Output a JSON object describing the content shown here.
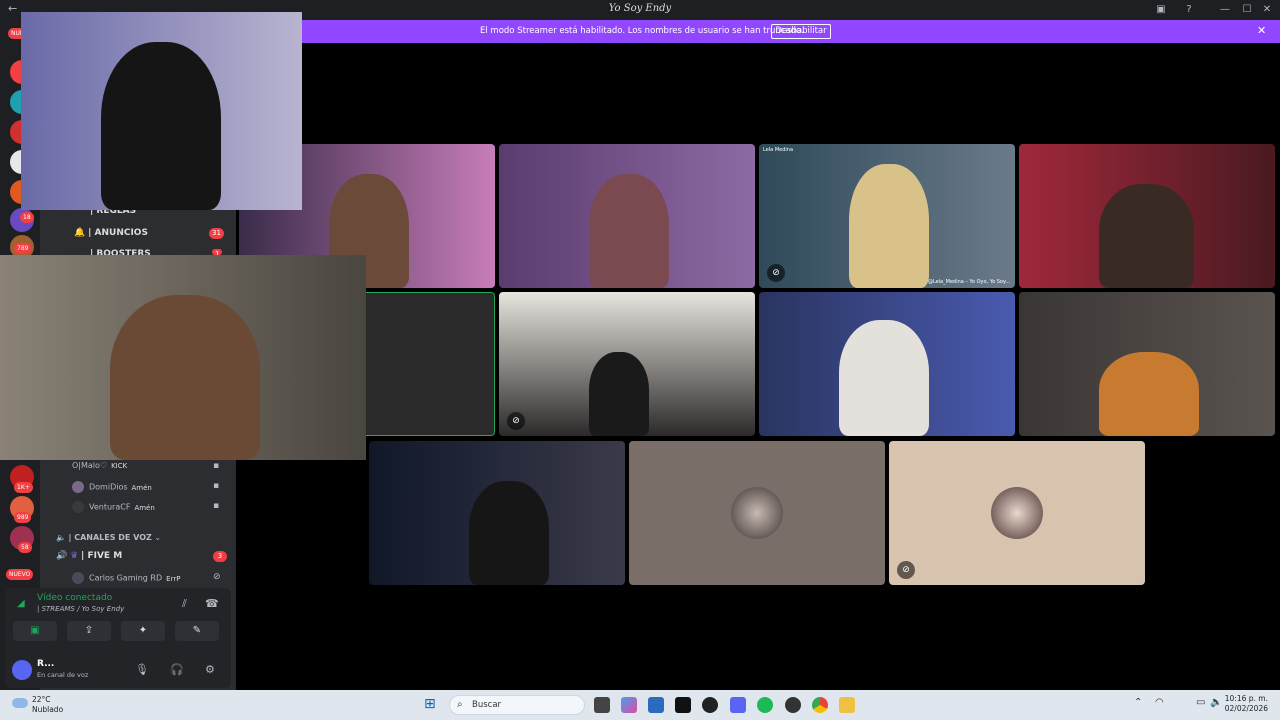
{
  "window": {
    "title": "Yo Soy Endy",
    "back_label": "←",
    "minimize": "—",
    "maximize": "☐",
    "close": "✕"
  },
  "banner": {
    "message": "El modo Streamer está habilitado. Los nombres de usuario se han truncado.",
    "button": "Deshabilitar",
    "close": "✕"
  },
  "tiles": {
    "top_right_name": "Lela Medina",
    "top_right_caption": "@Lela_Medina – Yo Oyo, Yo Soy..."
  },
  "servers": {
    "badges": [
      "NUEVO",
      "18",
      "789",
      "1K+",
      "989",
      "58",
      "NUEVO"
    ]
  },
  "channels": {
    "reglas": "| REGLAS",
    "anuncios": "| ANUNCIOS",
    "anuncios_badge": "31",
    "boosters": "| BOOSTERS",
    "boosters_badge": "1",
    "voice_header": "| CANALES DE VOZ",
    "five_m": "| FIVE M",
    "five_m_badge": "3"
  },
  "members": [
    {
      "name": "O|Malo♡",
      "tag": "KICK"
    },
    {
      "name": "DomiDios",
      "tag": "Amén"
    },
    {
      "name": "VenturaCF",
      "tag": "Amén"
    },
    {
      "name": "Carlos Gaming RD",
      "tag": "ErrP"
    }
  ],
  "voice_panel": {
    "status": "Vídeo conectado",
    "location": "| STREAMS / Yo Soy Endy",
    "buttons": [
      "▣",
      "⇪",
      "✦",
      "✎"
    ]
  },
  "user": {
    "name": "R...",
    "status": "En canal de voz"
  },
  "taskbar": {
    "temperature": "22°C",
    "condition": "Nublado",
    "search_label": "Buscar",
    "time": "10:16 p. m.",
    "date": "02/02/2026"
  },
  "colors": {
    "banner": "#9147ff",
    "sidebar": "#2b2d31",
    "connected": "#23a55a",
    "badge": "#f23f43"
  }
}
